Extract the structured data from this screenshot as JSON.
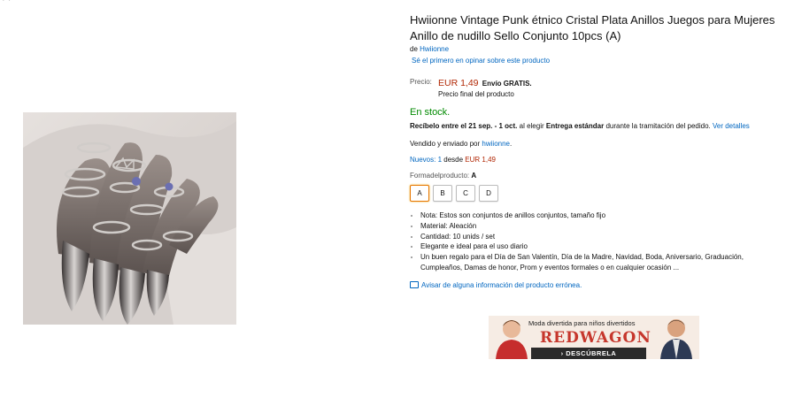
{
  "product": {
    "title": "Hwiionne Vintage Punk étnico Cristal Plata Anillos Juegos para Mujeres Anillo de nudillo Sello Conjunto 10pcs (A)",
    "by_label": "de",
    "brand": "Hwiionne",
    "reviews_link": "Sé el primero en opinar sobre este producto",
    "price_label": "Precio:",
    "price": "EUR 1,49",
    "shipping": "Envío GRATIS.",
    "price_note": "Precio final del producto",
    "stock": "En stock.",
    "delivery_bold": "Recíbelo entre el 21 sep. - 1 oct.",
    "delivery_mid": " al elegir ",
    "delivery_bold2": "Entrega estándar",
    "delivery_tail": " durante la tramitación del pedido. ",
    "delivery_link": "Ver detalles",
    "seller_prefix": "Vendido y enviado por ",
    "seller": "hwiionne",
    "seller_suffix": ".",
    "new_label": "Nuevos: 1",
    "new_from": " desde ",
    "new_price": "EUR 1,49",
    "form_label": "Formadelproducto:",
    "form_value": "A",
    "variants": [
      "A",
      "B",
      "C",
      "D"
    ],
    "selected_variant": "A",
    "bullets": [
      "Nota: Estos son conjuntos de anillos conjuntos, tamaño fijo",
      "Material: Aleación",
      "Cantidad: 10 unids / set",
      "Elegante e ideal para el uso diario",
      "Un buen regalo para el Día de San Valentín, Día de la Madre, Navidad, Boda, Aniversario, Graduación, Cumpleaños, Damas de honor, Prom y eventos formales o en cualquier ocasión ..."
    ],
    "report_link": "Avisar de alguna información del producto errónea."
  },
  "ad": {
    "tagline": "Moda divertida para niños divertidos",
    "brand": "REDWAGON",
    "cta": "› DESCÚBRELA"
  },
  "colors": {
    "link": "#0066c0",
    "price": "#b12704",
    "stock": "#008a00",
    "selected_border": "#e77600",
    "ad_brand": "#c6362c"
  }
}
